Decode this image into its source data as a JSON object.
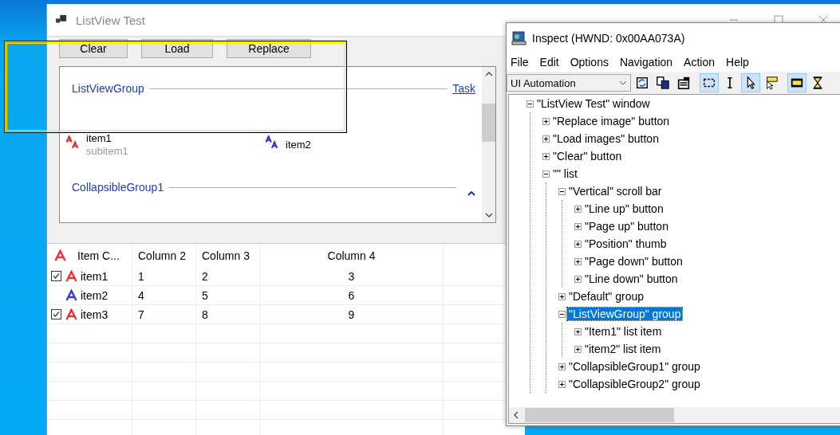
{
  "main_window": {
    "title": "ListView Test",
    "buttons": [
      "Clear",
      "Load",
      "Replace"
    ],
    "group_view": {
      "groups": [
        {
          "header": "ListViewGroup",
          "task_link": "Task",
          "items": [
            {
              "label": "item1",
              "subitem": "subitem1",
              "color": "#e8303a"
            },
            {
              "label": "item2",
              "color": "#3a3ad0"
            }
          ]
        },
        {
          "header": "CollapsibleGroup1",
          "expanded": true
        }
      ]
    },
    "details": {
      "columns": [
        "Item C...",
        "Column 2",
        "Column 3",
        "Column 4"
      ],
      "rows": [
        {
          "checked": true,
          "color": "#e8303a",
          "cells": [
            "item1",
            "1",
            "2",
            "3"
          ]
        },
        {
          "checked": false,
          "color": "#3a3ad0",
          "cells": [
            "item2",
            "4",
            "5",
            "6"
          ]
        },
        {
          "checked": true,
          "color": "#e8303a",
          "cells": [
            "item3",
            "7",
            "8",
            "9"
          ]
        }
      ]
    }
  },
  "inspect": {
    "title": "Inspect  (HWND: 0x00AA073A)",
    "menu": [
      "File",
      "Edit",
      "Options",
      "Navigation",
      "Action",
      "Help"
    ],
    "mode_dropdown": {
      "value": "UI Automation"
    },
    "toolbar": [
      {
        "kind": "refresh",
        "selected": false
      },
      {
        "kind": "copy",
        "selected": false
      },
      {
        "kind": "properties",
        "selected": false
      },
      {
        "kind": "rectangle",
        "selected": true
      },
      {
        "kind": "text-cursor",
        "selected": false
      },
      {
        "kind": "pointer",
        "selected": true
      },
      {
        "kind": "tooltip-pointer",
        "selected": false
      },
      {
        "kind": "highlight",
        "selected": true
      },
      {
        "kind": "hourglass",
        "selected": false
      }
    ],
    "tree": [
      {
        "label": "\"ListView Test\" window",
        "expanded": true,
        "selected": false,
        "children": [
          {
            "label": "\"Replace image\" button",
            "expanded": false,
            "selected": false
          },
          {
            "label": "\"Load images\" button",
            "expanded": false,
            "selected": false
          },
          {
            "label": "\"Clear\" button",
            "expanded": false,
            "selected": false
          },
          {
            "label": "\"\" list",
            "expanded": true,
            "selected": false,
            "children": [
              {
                "label": "\"Vertical\" scroll bar",
                "expanded": true,
                "selected": false,
                "children": [
                  {
                    "label": "\"Line up\" button",
                    "expanded": false,
                    "selected": false
                  },
                  {
                    "label": "\"Page up\" button",
                    "expanded": false,
                    "selected": false
                  },
                  {
                    "label": "\"Position\" thumb",
                    "expanded": false,
                    "selected": false
                  },
                  {
                    "label": "\"Page down\" button",
                    "expanded": false,
                    "selected": false
                  },
                  {
                    "label": "\"Line down\" button",
                    "expanded": false,
                    "selected": false
                  }
                ]
              },
              {
                "label": "\"Default\" group",
                "expanded": false,
                "selected": false
              },
              {
                "label": "\"ListViewGroup\" group",
                "expanded": true,
                "selected": true,
                "children": [
                  {
                    "label": "\"Item1\" list item",
                    "expanded": false,
                    "selected": false
                  },
                  {
                    "label": "\"item2\" list item",
                    "expanded": false,
                    "selected": false
                  }
                ]
              },
              {
                "label": "\"CollapsibleGroup1\" group",
                "expanded": false,
                "selected": false
              },
              {
                "label": "\"CollapsibleGroup2\" group",
                "expanded": false,
                "selected": false
              }
            ]
          }
        ]
      }
    ]
  }
}
